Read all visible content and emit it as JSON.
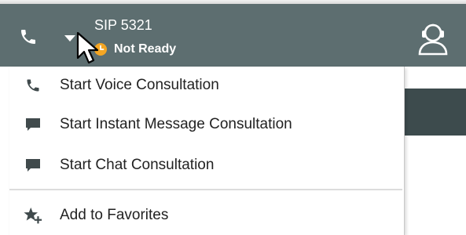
{
  "header": {
    "title": "SIP 5321",
    "status": "Not Ready",
    "icons": {
      "call": "phone-icon",
      "menu_toggle": "caret-down-icon",
      "status": "clock-icon",
      "agent": "agent-headset-icon"
    }
  },
  "menu": {
    "items": [
      {
        "label": "Start Voice Consultation",
        "icon": "phone-icon"
      },
      {
        "label": "Start Instant Message Consultation",
        "icon": "chat-bubble-icon"
      },
      {
        "label": "Start Chat Consultation",
        "icon": "chat-bubble-icon"
      },
      {
        "label": "Add to Favorites",
        "icon": "star-add-icon"
      }
    ]
  },
  "colors": {
    "toolbar": "#5d6e70",
    "status_orange": "#f5a623",
    "menu_text": "#222222",
    "icon_dark": "#404a4c"
  }
}
